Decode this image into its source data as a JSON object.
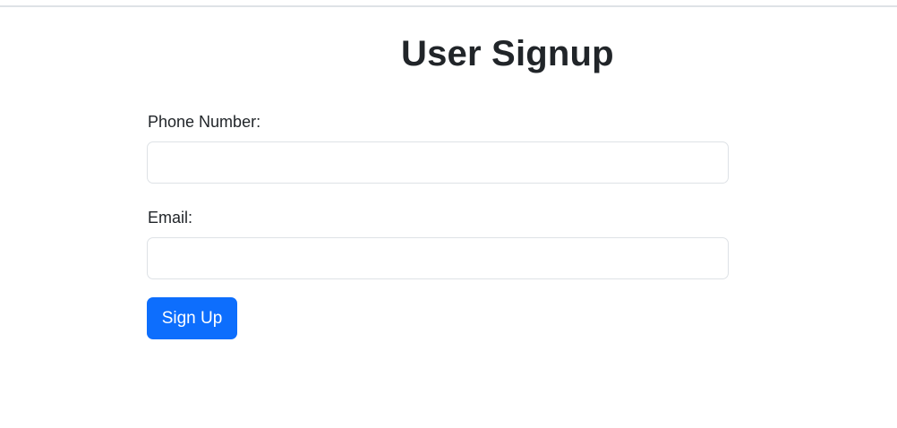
{
  "form": {
    "title": "User Signup",
    "phone_label": "Phone Number:",
    "phone_value": "",
    "email_label": "Email:",
    "email_value": "",
    "submit_label": "Sign Up"
  },
  "colors": {
    "primary": "#0d6efd",
    "text": "#212529",
    "border": "#dee2e6"
  }
}
